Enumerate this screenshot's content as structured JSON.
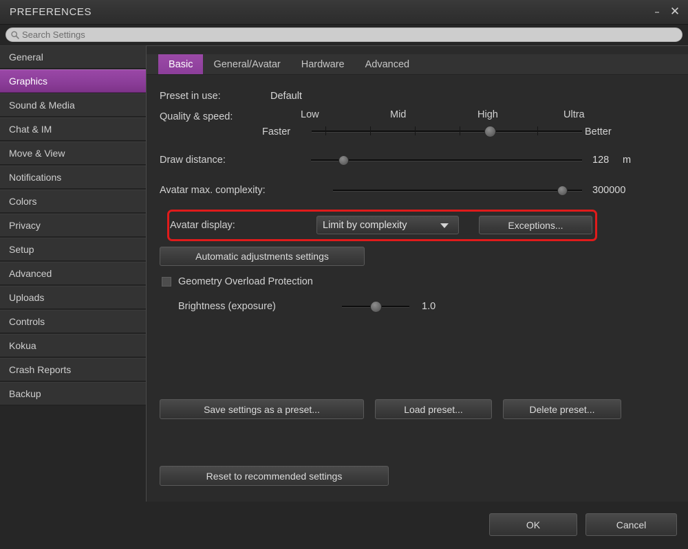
{
  "window": {
    "title": "PREFERENCES",
    "minimize_label": "–",
    "close_label": "✕",
    "minimize_icon": "minimize-icon",
    "close_icon": "close-icon"
  },
  "search": {
    "icon": "search-icon",
    "placeholder": "Search Settings",
    "value": ""
  },
  "sidebar": {
    "items": [
      {
        "label": "General",
        "selected": false
      },
      {
        "label": "Graphics",
        "selected": true
      },
      {
        "label": "Sound & Media",
        "selected": false
      },
      {
        "label": "Chat & IM",
        "selected": false
      },
      {
        "label": "Move & View",
        "selected": false
      },
      {
        "label": "Notifications",
        "selected": false
      },
      {
        "label": "Colors",
        "selected": false
      },
      {
        "label": "Privacy",
        "selected": false
      },
      {
        "label": "Setup",
        "selected": false
      },
      {
        "label": "Advanced",
        "selected": false
      },
      {
        "label": "Uploads",
        "selected": false
      },
      {
        "label": "Controls",
        "selected": false
      },
      {
        "label": "Kokua",
        "selected": false
      },
      {
        "label": "Crash Reports",
        "selected": false
      },
      {
        "label": "Backup",
        "selected": false
      }
    ]
  },
  "tabs": [
    {
      "label": "Basic",
      "active": true
    },
    {
      "label": "General/Avatar",
      "active": false
    },
    {
      "label": "Hardware",
      "active": false
    },
    {
      "label": "Advanced",
      "active": false
    }
  ],
  "basic": {
    "preset_in_use_label": "Preset in use:",
    "preset_in_use_value": "Default",
    "quality_label": "Quality & speed:",
    "quality_tiers": [
      "Low",
      "Mid",
      "High",
      "Ultra"
    ],
    "quality_left_end": "Faster",
    "quality_right_end": "Better",
    "quality_thumb_percent": 66,
    "draw_distance_label": "Draw distance:",
    "draw_distance_value": "128",
    "draw_distance_unit": "m",
    "draw_distance_thumb_percent": 12,
    "avatar_complexity_label": "Avatar max. complexity:",
    "avatar_complexity_value": "300000",
    "avatar_complexity_thumb_percent": 92,
    "avatar_display_label": "Avatar display:",
    "avatar_display_selected": "Limit by complexity",
    "avatar_display_options": [
      "Limit by complexity"
    ],
    "exceptions_button": "Exceptions...",
    "automatic_adjustments_button": "Automatic adjustments settings",
    "geometry_overload_label": "Geometry Overload Protection",
    "geometry_overload_checked": false,
    "brightness_label": "Brightness (exposure)",
    "brightness_value": "1.0",
    "brightness_thumb_percent": 50,
    "save_preset_button": "Save settings as a preset...",
    "load_preset_button": "Load preset...",
    "delete_preset_button": "Delete preset...",
    "reset_button": "Reset to recommended settings"
  },
  "footer": {
    "ok_button": "OK",
    "cancel_button": "Cancel"
  },
  "colors": {
    "accent_purple": "#8c3e9a",
    "annotation_red": "#e01b1b",
    "window_bg": "#262626",
    "panel_bg": "#2b2b2b",
    "sidebar_item_bg": "#333333"
  }
}
